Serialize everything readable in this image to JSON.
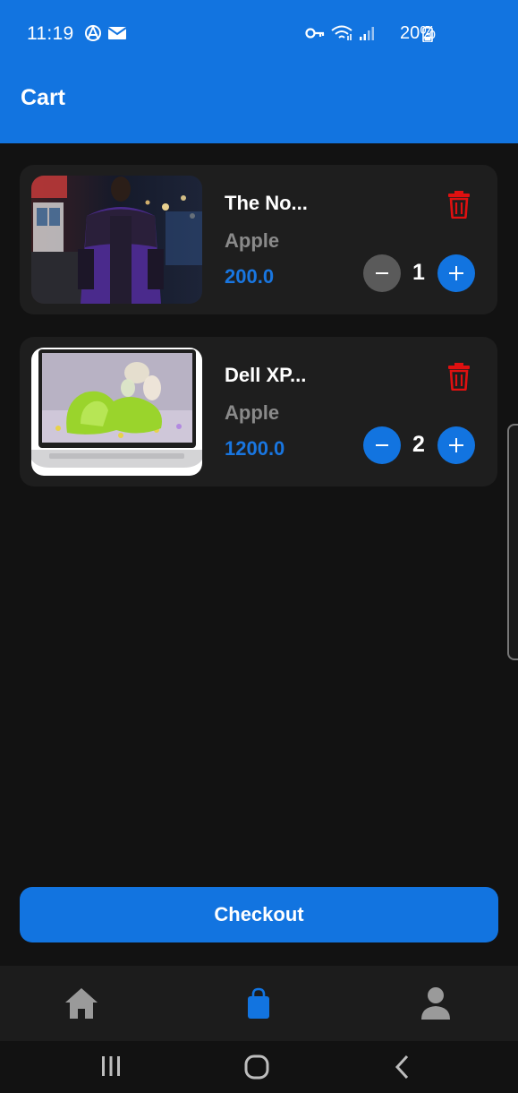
{
  "status_bar": {
    "time": "11:19",
    "battery": "20%"
  },
  "app_bar": {
    "title": "Cart"
  },
  "cart": {
    "items": [
      {
        "name": "The No...",
        "brand": "Apple",
        "price": "200.0",
        "quantity": "1",
        "minus_state": "disabled"
      },
      {
        "name": "Dell XP...",
        "brand": "Apple",
        "price": "1200.0",
        "quantity": "2",
        "minus_state": "enabled"
      }
    ]
  },
  "checkout": {
    "label": "Checkout"
  },
  "bottom_nav": {
    "items": [
      {
        "icon": "home-icon",
        "active": false
      },
      {
        "icon": "shopping-bag-icon",
        "active": true
      },
      {
        "icon": "person-icon",
        "active": false
      }
    ]
  },
  "colors": {
    "primary": "#1274e0",
    "background": "#121212",
    "card": "#1e1e1e",
    "price": "#1976e0",
    "muted": "#8a8a8a",
    "danger": "#e01010",
    "disabled": "#5a5a5a"
  }
}
